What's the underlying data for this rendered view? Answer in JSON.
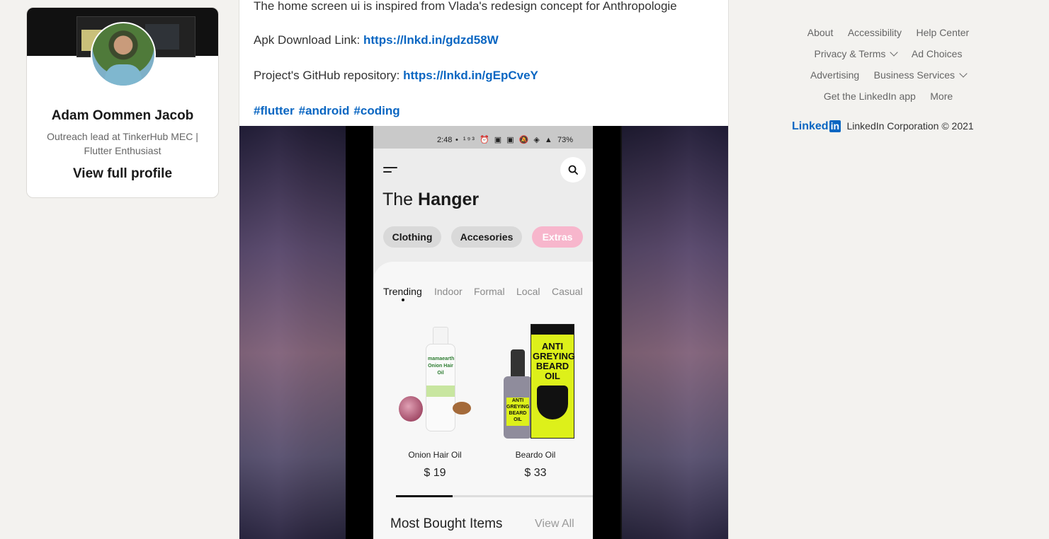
{
  "profile": {
    "name": "Adam Oommen Jacob",
    "headline": "Outreach lead at TinkerHub MEC | Flutter Enthusiast",
    "view_profile": "View full profile"
  },
  "post": {
    "line1": "The home screen ui is inspired from Vlada's redesign concept for Anthropologie",
    "apk_label": "Apk Download Link: ",
    "apk_link": "https://lnkd.in/gdzd58W",
    "repo_label": "Project's GitHub repository: ",
    "repo_link": "https://lnkd.in/gEpCveY",
    "hashtags": [
      "#flutter",
      "#android",
      "#coding"
    ]
  },
  "app": {
    "status_time": "2:48",
    "status_icons": "• ¹⁹³ ⏰ ▣ ▣ 🔕 ◈ ▲",
    "battery": "73%",
    "title_light": "The ",
    "title_bold": "Hanger",
    "chips": [
      "Clothing",
      "Accesories",
      "Extras"
    ],
    "tabs": [
      "Trending",
      "Indoor",
      "Formal",
      "Local",
      "Casual"
    ],
    "products": [
      {
        "name": "Onion Hair Oil",
        "price": "$ 19",
        "brand": "mamaearth",
        "label": "Onion Hair Oil"
      },
      {
        "name": "Beardo Oil",
        "price": "$ 33",
        "box_text": "ANTI GREYING BEARD OIL",
        "bottle_text": "ANTI GREYING BEARD OIL"
      }
    ],
    "section_title": "Most Bought Items",
    "view_all": "View All"
  },
  "footer": {
    "row1": [
      "About",
      "Accessibility",
      "Help Center"
    ],
    "row2": [
      "Privacy & Terms",
      "Ad Choices"
    ],
    "row3": [
      "Advertising",
      "Business Services"
    ],
    "row4": [
      "Get the LinkedIn app",
      "More"
    ],
    "logo_text": "Linked",
    "logo_box": "in",
    "copyright": "LinkedIn Corporation © 2021"
  },
  "colors": {
    "link": "#0a66c2",
    "page_bg": "#f3f2ef",
    "chip_pink": "#f7b6cc"
  }
}
